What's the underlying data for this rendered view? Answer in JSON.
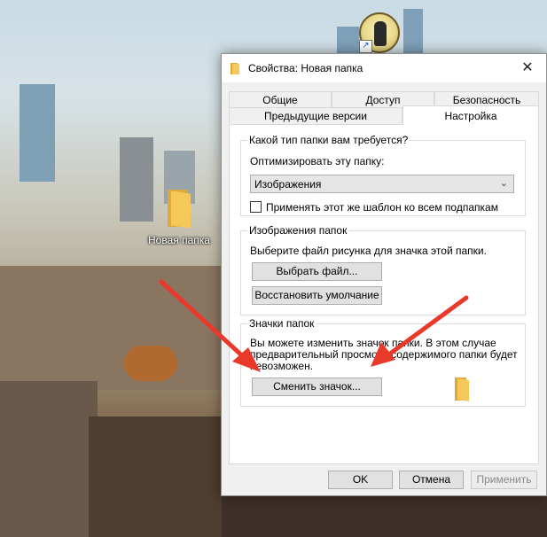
{
  "dialog": {
    "title": "Свойства: Новая папка",
    "close_glyph": "✕",
    "tabs": {
      "general": "Общие",
      "access": "Доступ",
      "security": "Безопасность",
      "previous": "Предыдущие версии",
      "customize": "Настройка"
    },
    "folder_type": {
      "title": "Какой тип папки вам требуется?",
      "optimize_label": "Оптимизировать эту папку:",
      "selected": "Изображения",
      "apply_subfolders_label": "Применять этот же шаблон ко всем подпапкам",
      "apply_subfolders_checked": false
    },
    "folder_pictures": {
      "title": "Изображения папок",
      "description": "Выберите файл рисунка для значка этой папки.",
      "choose_file_button": "Выбрать файл...",
      "restore_default_button": "Восстановить умолчание"
    },
    "folder_icons": {
      "title": "Значки папок",
      "description_line1": "Вы можете изменить значок папки. В этом случае",
      "description_line2": "предварительный просмотр содержимого папки будет",
      "description_line3": "невозможен.",
      "change_icon_button": "Сменить значок..."
    },
    "buttons": {
      "ok": "OK",
      "cancel": "Отмена",
      "apply": "Применить"
    }
  },
  "desktop": {
    "folder_label": "Новая папка",
    "shortcut_glyph": "↗"
  },
  "annotation": {
    "arrow_color": "#e8392b"
  }
}
